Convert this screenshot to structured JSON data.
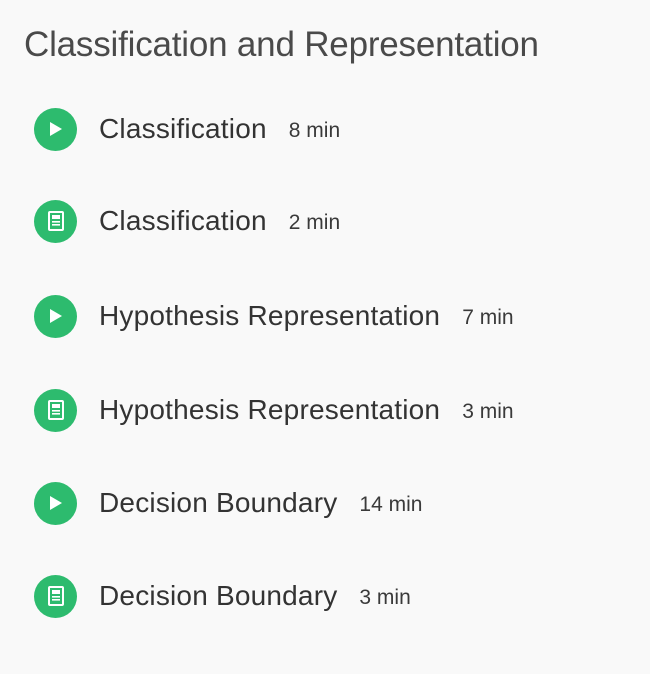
{
  "module": {
    "title": "Classification and Representation",
    "accent_color": "#2dbb6e",
    "items": [
      {
        "type": "video",
        "icon": "play-icon",
        "title": "Classification",
        "duration": "8 min"
      },
      {
        "type": "reading",
        "icon": "reading-icon",
        "title": "Classification",
        "duration": "2 min"
      },
      {
        "type": "video",
        "icon": "play-icon",
        "title": "Hypothesis Representation",
        "duration": "7 min"
      },
      {
        "type": "reading",
        "icon": "reading-icon",
        "title": "Hypothesis Representation",
        "duration": "3 min"
      },
      {
        "type": "video",
        "icon": "play-icon",
        "title": "Decision Boundary",
        "duration": "14 min"
      },
      {
        "type": "reading",
        "icon": "reading-icon",
        "title": "Decision Boundary",
        "duration": "3 min"
      }
    ]
  }
}
